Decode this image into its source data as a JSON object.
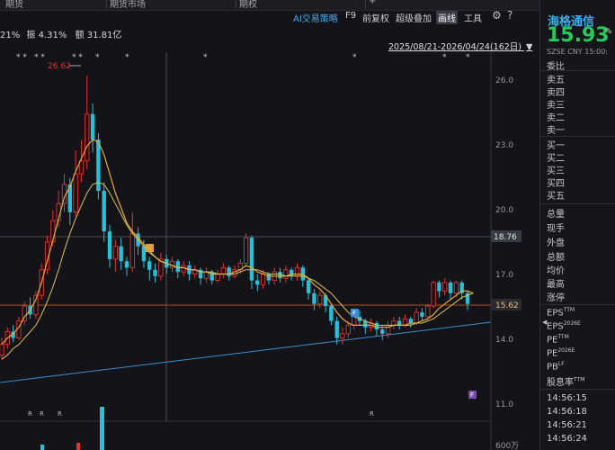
{
  "tabs": [
    "期货",
    "期货市场",
    "期权",
    "+"
  ],
  "toolbar": {
    "ai_strategy": "AI交易策略",
    "f9": "F9",
    "adjust": "前复权",
    "overlay": "超级叠加",
    "draw": "画线",
    "tools": "工具"
  },
  "info": {
    "partial": "21%",
    "amplitude": "振 4.31%",
    "turnover": "额 31.81亿"
  },
  "range_label": "2025/08/21-2026/04/24(162日)",
  "stock": {
    "name": "海格通信",
    "price": "15.93",
    "meta": "SZSE  CNY  15:00:"
  },
  "order_book": {
    "ratio": "委比",
    "asks": [
      "卖五",
      "卖四",
      "卖三",
      "卖二",
      "卖一"
    ],
    "bids": [
      "买一",
      "买二",
      "买三",
      "买四",
      "买五"
    ]
  },
  "stats": [
    "总量",
    "现手",
    "外盘",
    "总额",
    "均价",
    "最高",
    "涨停"
  ],
  "fundamentals": [
    {
      "label": "EPS",
      "sup": "TTM"
    },
    {
      "label": "EPS",
      "sup": "2026E"
    },
    {
      "label": "PE",
      "sup": "TTM"
    },
    {
      "label": "PE",
      "sup": "2026E"
    },
    {
      "label": "PB",
      "sup": "LF"
    },
    {
      "label": "股息率",
      "sup": "TTM"
    }
  ],
  "ticks": [
    "14:56:15",
    "14:56:18",
    "14:56:21",
    "14:56:24"
  ],
  "chart_data": {
    "type": "candlestick",
    "y_ticks": [
      "26.0",
      "23.0",
      "20.0",
      "17.0",
      "14.0",
      "11.0"
    ],
    "ylim": [
      10.4,
      27.7
    ],
    "crosshair_price": "18.76",
    "last_price": "15.62",
    "high_annotation": "26.62",
    "volume_label": "600万",
    "candles": [
      {
        "o": 13.5,
        "c": 14.0,
        "h": 14.3,
        "l": 13.3
      },
      {
        "o": 14.0,
        "c": 14.6,
        "h": 14.8,
        "l": 13.8
      },
      {
        "o": 14.6,
        "c": 14.3,
        "h": 14.9,
        "l": 14.1
      },
      {
        "o": 14.3,
        "c": 15.1,
        "h": 15.3,
        "l": 14.2
      },
      {
        "o": 15.1,
        "c": 15.8,
        "h": 16.0,
        "l": 14.9
      },
      {
        "o": 15.8,
        "c": 15.4,
        "h": 16.2,
        "l": 15.2
      },
      {
        "o": 15.4,
        "c": 16.3,
        "h": 16.5,
        "l": 15.2
      },
      {
        "o": 16.3,
        "c": 17.5,
        "h": 17.8,
        "l": 16.1
      },
      {
        "o": 17.5,
        "c": 18.8,
        "h": 19.1,
        "l": 17.3
      },
      {
        "o": 18.8,
        "c": 19.8,
        "h": 20.3,
        "l": 18.6
      },
      {
        "o": 19.8,
        "c": 20.6,
        "h": 21.2,
        "l": 19.5
      },
      {
        "o": 20.6,
        "c": 21.5,
        "h": 22.0,
        "l": 20.2
      },
      {
        "o": 21.5,
        "c": 20.2,
        "h": 21.8,
        "l": 19.6
      },
      {
        "o": 20.2,
        "c": 22.0,
        "h": 23.1,
        "l": 20.0
      },
      {
        "o": 22.0,
        "c": 22.6,
        "h": 23.6,
        "l": 21.6
      },
      {
        "o": 22.6,
        "c": 24.8,
        "h": 26.6,
        "l": 22.2
      },
      {
        "o": 24.8,
        "c": 23.6,
        "h": 25.3,
        "l": 23.0
      },
      {
        "o": 23.6,
        "c": 21.2,
        "h": 23.9,
        "l": 20.8
      },
      {
        "o": 21.2,
        "c": 19.3,
        "h": 21.6,
        "l": 18.8
      },
      {
        "o": 19.3,
        "c": 18.0,
        "h": 19.6,
        "l": 17.6
      },
      {
        "o": 18.0,
        "c": 18.6,
        "h": 18.9,
        "l": 17.4
      },
      {
        "o": 18.6,
        "c": 17.9,
        "h": 19.0,
        "l": 17.5
      },
      {
        "o": 17.9,
        "c": 17.6,
        "h": 18.1,
        "l": 17.2
      },
      {
        "o": 17.6,
        "c": 19.2,
        "h": 20.2,
        "l": 17.4
      },
      {
        "o": 19.2,
        "c": 18.6,
        "h": 19.5,
        "l": 18.2
      },
      {
        "o": 18.6,
        "c": 17.9,
        "h": 18.9,
        "l": 17.6
      },
      {
        "o": 17.9,
        "c": 17.5,
        "h": 18.1,
        "l": 17.0
      },
      {
        "o": 17.5,
        "c": 17.2,
        "h": 17.8,
        "l": 16.9
      },
      {
        "o": 17.2,
        "c": 18.0,
        "h": 18.3,
        "l": 17.0
      },
      {
        "o": 18.0,
        "c": 17.6,
        "h": 18.2,
        "l": 17.3
      },
      {
        "o": 17.6,
        "c": 17.9,
        "h": 18.1,
        "l": 17.4
      },
      {
        "o": 17.9,
        "c": 17.4,
        "h": 18.0,
        "l": 17.1
      },
      {
        "o": 17.4,
        "c": 17.7,
        "h": 17.9,
        "l": 17.2
      },
      {
        "o": 17.7,
        "c": 17.3,
        "h": 17.9,
        "l": 17.0
      },
      {
        "o": 17.3,
        "c": 17.5,
        "h": 17.7,
        "l": 17.1
      },
      {
        "o": 17.5,
        "c": 17.1,
        "h": 17.6,
        "l": 16.8
      },
      {
        "o": 17.1,
        "c": 17.4,
        "h": 17.6,
        "l": 16.9
      },
      {
        "o": 17.4,
        "c": 17.0,
        "h": 17.5,
        "l": 16.8
      },
      {
        "o": 17.0,
        "c": 17.3,
        "h": 17.5,
        "l": 16.9
      },
      {
        "o": 17.3,
        "c": 17.6,
        "h": 17.8,
        "l": 17.1
      },
      {
        "o": 17.6,
        "c": 17.2,
        "h": 17.7,
        "l": 17.0
      },
      {
        "o": 17.2,
        "c": 17.5,
        "h": 17.7,
        "l": 17.1
      },
      {
        "o": 17.5,
        "c": 17.8,
        "h": 18.0,
        "l": 17.3
      },
      {
        "o": 17.8,
        "c": 19.0,
        "h": 19.2,
        "l": 17.6
      },
      {
        "o": 19.0,
        "c": 17.0,
        "h": 19.1,
        "l": 16.6
      },
      {
        "o": 17.0,
        "c": 16.8,
        "h": 17.3,
        "l": 16.5
      },
      {
        "o": 16.8,
        "c": 17.3,
        "h": 17.5,
        "l": 16.6
      },
      {
        "o": 17.3,
        "c": 17.0,
        "h": 17.4,
        "l": 16.8
      },
      {
        "o": 17.0,
        "c": 17.4,
        "h": 17.6,
        "l": 16.8
      },
      {
        "o": 17.4,
        "c": 17.1,
        "h": 17.6,
        "l": 16.9
      },
      {
        "o": 17.1,
        "c": 17.5,
        "h": 17.7,
        "l": 16.9
      },
      {
        "o": 17.5,
        "c": 17.2,
        "h": 17.6,
        "l": 17.0
      },
      {
        "o": 17.2,
        "c": 17.6,
        "h": 17.8,
        "l": 17.0
      },
      {
        "o": 17.6,
        "c": 17.0,
        "h": 17.7,
        "l": 16.7
      },
      {
        "o": 17.0,
        "c": 16.4,
        "h": 17.1,
        "l": 16.1
      },
      {
        "o": 16.4,
        "c": 15.9,
        "h": 16.6,
        "l": 15.6
      },
      {
        "o": 15.9,
        "c": 16.3,
        "h": 16.5,
        "l": 15.7
      },
      {
        "o": 16.3,
        "c": 15.8,
        "h": 16.4,
        "l": 15.5
      },
      {
        "o": 15.8,
        "c": 15.1,
        "h": 15.9,
        "l": 14.9
      },
      {
        "o": 15.1,
        "c": 14.3,
        "h": 15.3,
        "l": 14.0
      },
      {
        "o": 14.3,
        "c": 14.5,
        "h": 14.8,
        "l": 14.0
      },
      {
        "o": 14.5,
        "c": 14.9,
        "h": 15.1,
        "l": 14.3
      },
      {
        "o": 14.9,
        "c": 15.3,
        "h": 15.5,
        "l": 14.7
      },
      {
        "o": 15.3,
        "c": 15.1,
        "h": 15.6,
        "l": 14.9
      },
      {
        "o": 15.1,
        "c": 14.8,
        "h": 15.2,
        "l": 14.5
      },
      {
        "o": 14.8,
        "c": 15.0,
        "h": 15.2,
        "l": 14.6
      },
      {
        "o": 15.0,
        "c": 14.7,
        "h": 15.1,
        "l": 14.4
      },
      {
        "o": 14.7,
        "c": 14.5,
        "h": 14.9,
        "l": 14.2
      },
      {
        "o": 14.5,
        "c": 14.9,
        "h": 15.1,
        "l": 14.3
      },
      {
        "o": 14.9,
        "c": 15.1,
        "h": 15.3,
        "l": 14.7
      },
      {
        "o": 15.1,
        "c": 14.9,
        "h": 15.3,
        "l": 14.7
      },
      {
        "o": 14.9,
        "c": 15.2,
        "h": 15.4,
        "l": 14.8
      },
      {
        "o": 15.2,
        "c": 15.0,
        "h": 15.3,
        "l": 14.8
      },
      {
        "o": 15.0,
        "c": 15.5,
        "h": 15.7,
        "l": 14.9
      },
      {
        "o": 15.5,
        "c": 15.3,
        "h": 15.7,
        "l": 15.1
      },
      {
        "o": 15.3,
        "c": 15.8,
        "h": 15.9,
        "l": 15.2
      },
      {
        "o": 15.8,
        "c": 16.9,
        "h": 17.0,
        "l": 15.7
      },
      {
        "o": 16.9,
        "c": 16.5,
        "h": 17.0,
        "l": 16.2
      },
      {
        "o": 16.5,
        "c": 16.9,
        "h": 17.1,
        "l": 16.3
      },
      {
        "o": 16.9,
        "c": 16.4,
        "h": 17.0,
        "l": 16.1
      },
      {
        "o": 16.4,
        "c": 16.9,
        "h": 17.0,
        "l": 16.2
      },
      {
        "o": 16.9,
        "c": 16.4,
        "h": 17.0,
        "l": 16.1
      },
      {
        "o": 16.4,
        "c": 15.9,
        "h": 16.5,
        "l": 15.6
      }
    ],
    "ma1": [
      14.0,
      14.3,
      14.5,
      14.8,
      15.3,
      15.6,
      16.1,
      16.9,
      17.9,
      18.9,
      19.9,
      20.9,
      21.4,
      22.1,
      22.7,
      23.3,
      23.6,
      23.5,
      22.9,
      22.0,
      21.1,
      20.4,
      19.7,
      19.3,
      19.0,
      18.7,
      18.4,
      18.1,
      17.9,
      17.8,
      17.7,
      17.6,
      17.6,
      17.5,
      17.5,
      17.4,
      17.4,
      17.3,
      17.3,
      17.3,
      17.3,
      17.4,
      17.5,
      17.7,
      17.6,
      17.4,
      17.3,
      17.2,
      17.2,
      17.2,
      17.2,
      17.3,
      17.3,
      17.3,
      17.1,
      16.8,
      16.6,
      16.3,
      15.9,
      15.5,
      15.2,
      15.0,
      14.9,
      14.9,
      14.9,
      14.9,
      14.8,
      14.8,
      14.8,
      14.9,
      14.9,
      14.9,
      15.0,
      15.0,
      15.1,
      15.2,
      15.4,
      15.7,
      15.9,
      16.1,
      16.3,
      16.5,
      16.5,
      16.4
    ],
    "ma2": [
      13.3,
      13.5,
      13.8,
      14.0,
      14.3,
      14.6,
      14.9,
      15.4,
      16.0,
      16.7,
      17.5,
      18.4,
      19.2,
      19.9,
      20.5,
      21.1,
      21.5,
      21.6,
      21.5,
      21.1,
      20.6,
      20.1,
      19.6,
      19.2,
      18.9,
      18.6,
      18.3,
      18.1,
      17.9,
      17.8,
      17.7,
      17.6,
      17.6,
      17.5,
      17.5,
      17.4,
      17.4,
      17.4,
      17.3,
      17.3,
      17.3,
      17.3,
      17.4,
      17.5,
      17.5,
      17.5,
      17.4,
      17.3,
      17.3,
      17.3,
      17.2,
      17.2,
      17.2,
      17.2,
      17.1,
      17.0,
      16.8,
      16.6,
      16.4,
      16.1,
      15.8,
      15.5,
      15.3,
      15.2,
      15.1,
      15.0,
      14.9,
      14.9,
      14.9,
      14.9,
      14.9,
      14.9,
      14.9,
      15.0,
      15.0,
      15.1,
      15.2,
      15.4,
      15.6,
      15.8,
      16.0,
      16.2,
      16.3,
      16.4
    ]
  }
}
